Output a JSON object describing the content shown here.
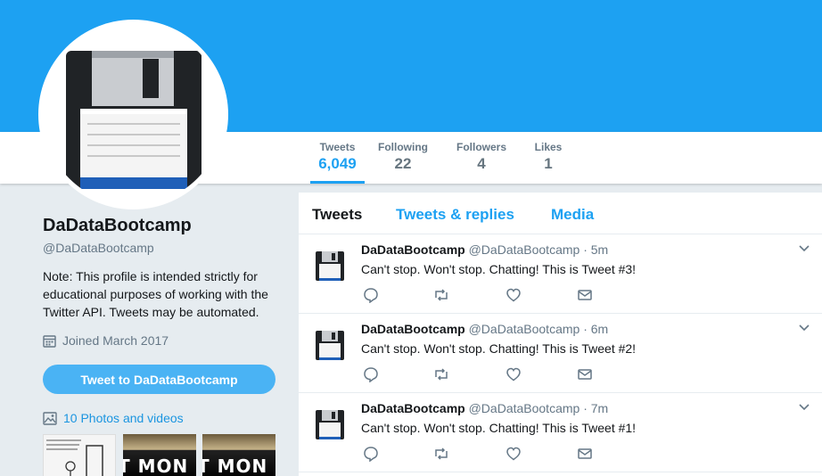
{
  "profile": {
    "name": "DaDataBootcamp",
    "handle": "@DaDataBootcamp",
    "bio": "Note: This profile is intended strictly for educational purposes of working with the Twitter API. Tweets may be automated.",
    "joined": "Joined March 2017",
    "tweet_to_label": "Tweet to DaDataBootcamp",
    "photos_label": "10 Photos and videos"
  },
  "stats": [
    {
      "label": "Tweets",
      "value": "6,049"
    },
    {
      "label": "Following",
      "value": "22"
    },
    {
      "label": "Followers",
      "value": "4"
    },
    {
      "label": "Likes",
      "value": "1"
    }
  ],
  "tabs": [
    "Tweets",
    "Tweets & replies",
    "Media"
  ],
  "tweets": [
    {
      "name": "DaDataBootcamp",
      "handle": "@DaDataBootcamp",
      "time": "· 5m",
      "text": "Can't stop. Won't stop. Chatting! This is Tweet #3!"
    },
    {
      "name": "DaDataBootcamp",
      "handle": "@DaDataBootcamp",
      "time": "· 6m",
      "text": "Can't stop. Won't stop. Chatting! This is Tweet #2!"
    },
    {
      "name": "DaDataBootcamp",
      "handle": "@DaDataBootcamp",
      "time": "· 7m",
      "text": "Can't stop. Won't stop. Chatting! This is Tweet #1!"
    }
  ],
  "thumbnails": {
    "text": "T MON"
  },
  "colors": {
    "accent": "#1da1f2",
    "background": "#e6ecf0",
    "button": "#4ab3f4"
  }
}
